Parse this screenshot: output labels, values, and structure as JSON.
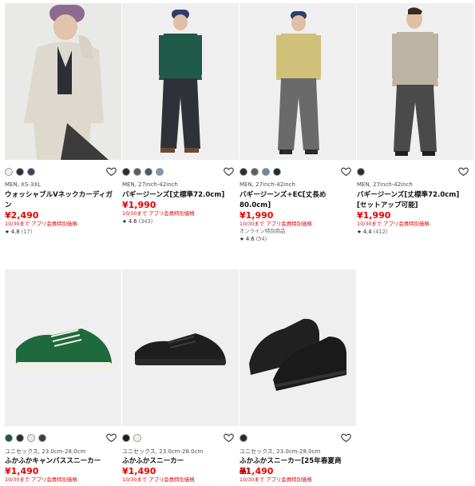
{
  "products": [
    {
      "meta": "MEN, XS-3XL",
      "name": "ウォッシャブルVネックカーディガン",
      "price": "¥2,490",
      "promo": "10/30まで アプリ会員特別価格",
      "online": "",
      "rating_star": "★",
      "rating": "4.8",
      "reviews": "(17)",
      "swatches": [
        "#f1efe9",
        "#2b2d3a",
        "#3a4660"
      ]
    },
    {
      "meta": "MEN, 27inch-42inch",
      "name": "バギージーンズ[丈標準72.0cm]",
      "price": "¥1,990",
      "promo": "10/30まで アプリ会員特別価格",
      "online": "",
      "rating_star": "★",
      "rating": "4.6",
      "reviews": "(343)",
      "swatches": [
        "#2c2c2c",
        "#5c5f62",
        "#4a5a6c",
        "#7b9ab7"
      ]
    },
    {
      "meta": "MEN, 27inch-42inch",
      "name": "バギージーンズ+EC[丈長め80.0cm]",
      "price": "¥1,990",
      "promo": "10/30まで アプリ会員特別価格",
      "online": "オンライン特別商品",
      "rating_star": "★",
      "rating": "4.6",
      "reviews": "(54)",
      "swatches": [
        "#2c2c2c",
        "#5c5f62",
        "#6f88a3",
        "#1f2a3a"
      ]
    },
    {
      "meta": "MEN, 27inch-42inch",
      "name": "バギージーンズ[丈標準72.0cm][セットアップ可能]",
      "price": "¥1,990",
      "promo": "10/30まで アプリ会員特別価格",
      "online": "",
      "rating_star": "★",
      "rating": "4.4",
      "reviews": "(412)",
      "swatches": [
        "#2f2f2f"
      ]
    },
    {
      "meta": "ユニセックス, 23.0cm-28.0cm",
      "name": "ふかふかキャンバススニーカー",
      "price": "¥1,490",
      "promo": "10/30まで アプリ会員特別価格",
      "online": "",
      "rating_star": "",
      "rating": "",
      "reviews": "",
      "swatches": [
        "#1f5a3a",
        "#2c2c2c",
        "#efe9dc",
        "#3a4432"
      ]
    },
    {
      "meta": "ユニセックス, 23.0cm-28.0cm",
      "name": "ふかふかスニーカー",
      "price": "¥1,490",
      "promo": "10/30まで アプリ会員特別価格",
      "online": "",
      "rating_star": "",
      "rating": "",
      "reviews": "",
      "swatches": [
        "#1e1e1e",
        "#f4f1ea"
      ]
    },
    {
      "meta": "ユニセックス, 23.0cm-28.0cm",
      "name": "ふかふかスニーカー[25年春夏商品]",
      "price": "¥1,490",
      "promo": "10/30まで アプリ会員特別価格",
      "online": "",
      "rating_star": "",
      "rating": "",
      "reviews": "",
      "swatches": [
        "#2a2a2a"
      ]
    }
  ],
  "colors": {
    "price": "#e60000",
    "image_bg": "#eeeeee"
  },
  "icons": {
    "favorite": "heart-outline-icon"
  }
}
